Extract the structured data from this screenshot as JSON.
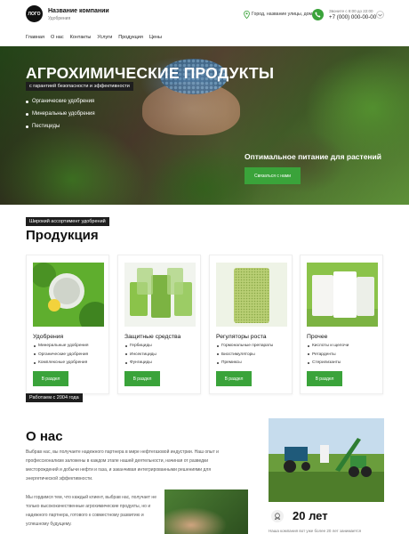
{
  "header": {
    "logo_text": "ЛОГО",
    "company_name": "Название компании",
    "company_sub": "Удобрения",
    "address": "Город, название улицы, дом 1",
    "hours": "Звоните с 8:00 до 22:00",
    "phone": "+7 (000) 000-00-00"
  },
  "nav": {
    "items": [
      "Главная",
      "О нас",
      "Контакты",
      "Услуги",
      "Продукция",
      "Цены"
    ]
  },
  "hero": {
    "title": "АГРОХИМИЧЕСКИЕ ПРОДУКТЫ",
    "subtitle": "с гарантией безопасности и эффективности",
    "list": [
      "Органические удобрения",
      "Минеральные удобрения",
      "Пестициды"
    ],
    "tagline": "Оптимальное питание для растений",
    "cta_label": "Связаться с нами"
  },
  "products": {
    "badge": "Широкий ассортимент удобрений",
    "title": "Продукция",
    "cards": [
      {
        "title": "Удобрения",
        "items": [
          "Минеральные удобрения",
          "Органические удобрения",
          "Комплексные удобрения"
        ],
        "button": "В раздел"
      },
      {
        "title": "Защитные средства",
        "items": [
          "Гербициды",
          "Инсектициды",
          "Фунгициды"
        ],
        "button": "В раздел"
      },
      {
        "title": "Регуляторы роста",
        "items": [
          "Гормональные препараты",
          "Биостимуляторы",
          "Премиксы"
        ],
        "button": "В раздел"
      },
      {
        "title": "Прочее",
        "items": [
          "Кислоты и щелочи",
          "Ретарденты",
          "Стерилизанты"
        ],
        "button": "В раздел"
      }
    ]
  },
  "about": {
    "badge": "Работаем с 2004 года",
    "title": "О нас",
    "paragraph1": "Выбрав нас, вы получаете надежного партнера в мире нефтегазовой индустрии. Наш опыт и профессионализм заложены в каждом этапе нашей деятельности, начиная от разведки месторождений и добычи нефти и газа, и заканчивая интегрированными решениями для энергетической эффективности.",
    "paragraph2": "Мы гордимся тем, что каждый клиент, выбрав нас, получает не только высококачественные агрохимические продукты, но и надежного партнера, готового к совместному развитию и успешному будущему.",
    "years": "20 лет",
    "years_sub": "Наша компания вот уже более 20 лет занимается"
  },
  "colors": {
    "accent": "#3aa33a",
    "dark_badge": "#1e1e1e"
  }
}
